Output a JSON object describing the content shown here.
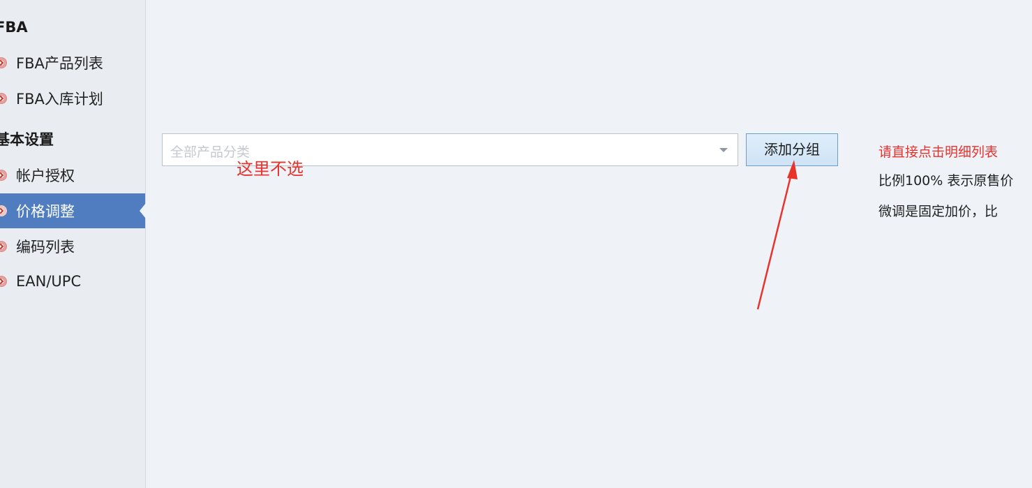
{
  "sidebar": {
    "sections": [
      {
        "title": "FBA",
        "items": [
          {
            "label": "FBA产品列表"
          },
          {
            "label": "FBA入库计划"
          }
        ]
      },
      {
        "title": "基本设置",
        "items": [
          {
            "label": "帐户授权"
          },
          {
            "label": "价格调整"
          },
          {
            "label": "编码列表"
          },
          {
            "label": "EAN/UPC"
          }
        ]
      }
    ],
    "active_item": "价格调整"
  },
  "main": {
    "category_select": {
      "placeholder": "全部产品分类"
    },
    "add_group_label": "添加分组",
    "annotation": "这里不选",
    "hints": {
      "line1": "请直接点击明细列表",
      "line2": "比例100% 表示原售价",
      "line3": "微调是固定加价，比"
    }
  },
  "colors": {
    "active_bg": "#4f7dbf",
    "annotation_red": "#e8322c",
    "page_bg": "#eff3f8"
  }
}
